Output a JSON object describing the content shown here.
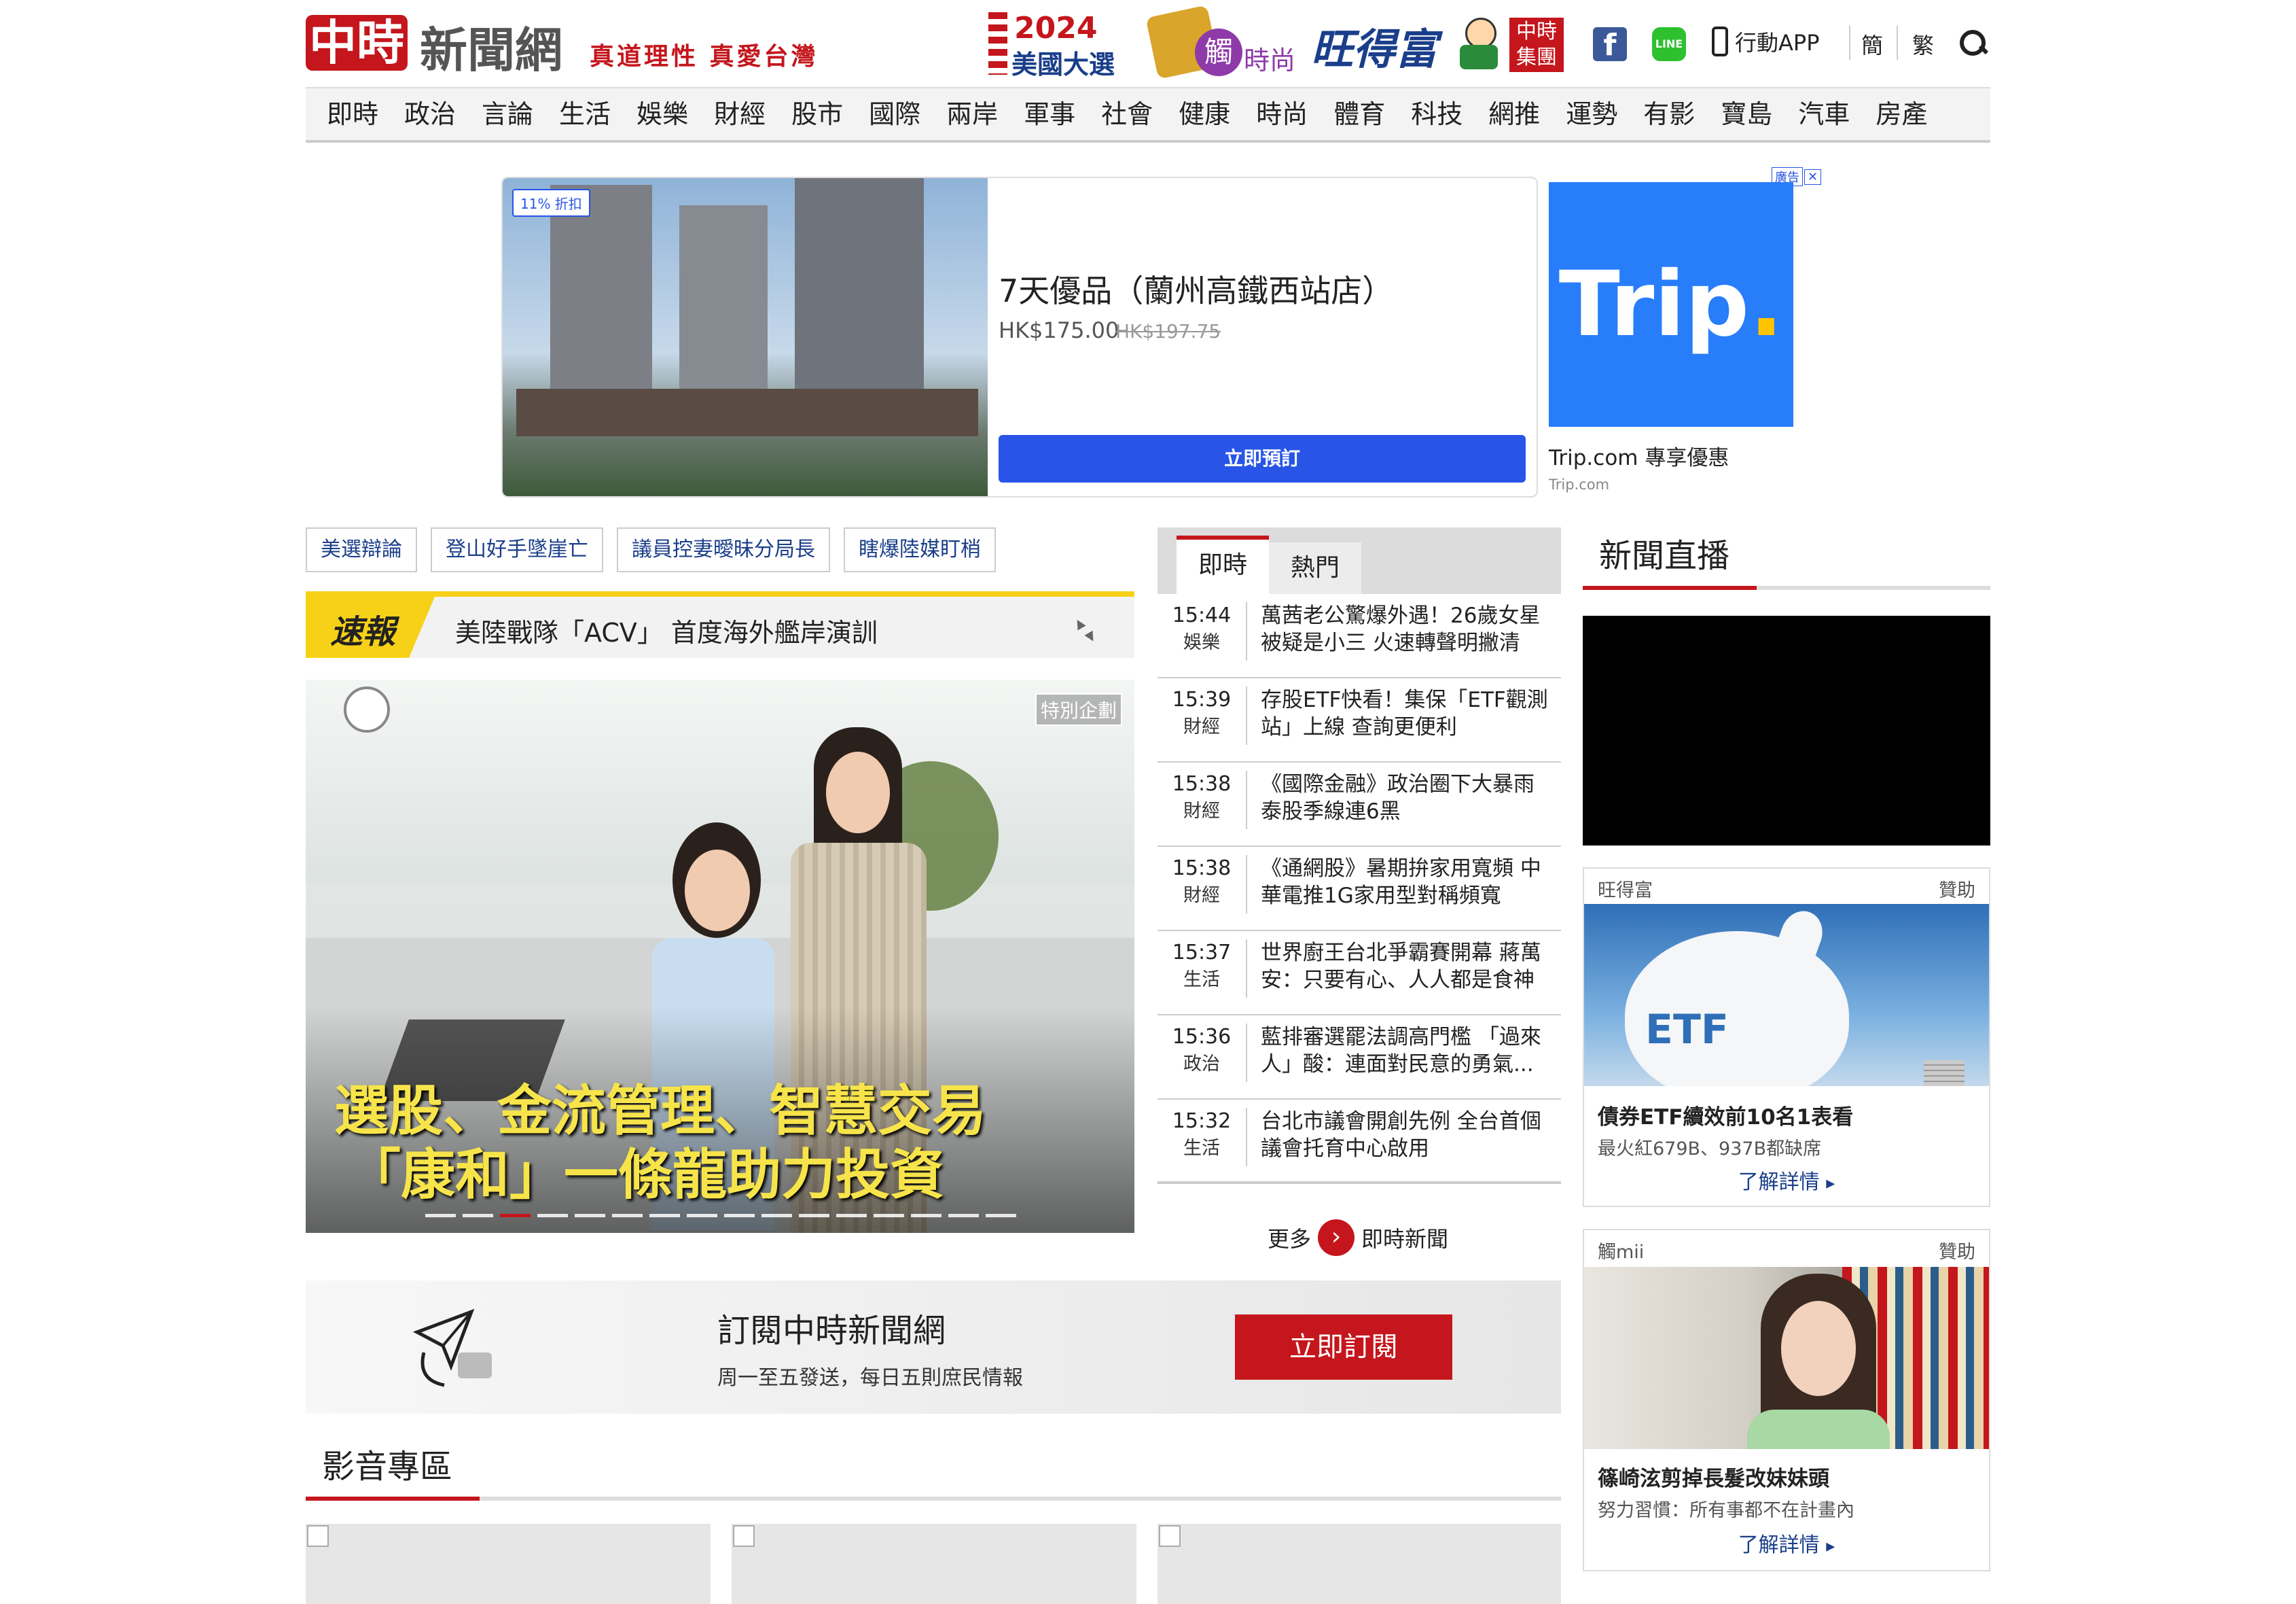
{
  "header": {
    "logo_box": "中時",
    "logo_text": "新聞網",
    "slogan": "真道理性 真愛台灣",
    "partner_election_year": "2024",
    "partner_election_label": "美國大選",
    "partner_fashion_char": "觸",
    "partner_fashion_label": "時尚",
    "partner_want": "旺得富",
    "partner_group": "中時集團",
    "app_label": "行動APP",
    "lang_simplified": "簡",
    "lang_traditional": "繁"
  },
  "categories": [
    "即時",
    "政治",
    "言論",
    "生活",
    "娛樂",
    "財經",
    "股市",
    "國際",
    "兩岸",
    "軍事",
    "社會",
    "健康",
    "時尚",
    "體育",
    "科技",
    "網推",
    "運勢",
    "有影",
    "寶島",
    "汽車",
    "房產"
  ],
  "ad": {
    "discount_badge": "11% 折扣",
    "hotel_name": "7天優品（蘭州高鐵西站店）",
    "price": "HK$175.00",
    "original_price": "HK$197.75",
    "book_button": "立即預訂",
    "ad_label": "廣告",
    "brand_logo": "Trip",
    "brand_dot": ".",
    "brand_title": "Trip.com 專享優惠",
    "brand_domain": "Trip.com"
  },
  "hot_tags": [
    "美選辯論",
    "登山好手墜崖亡",
    "議員控妻曖昧分局長",
    "瞎爆陸媒盯梢"
  ],
  "breaking": {
    "label": "速報",
    "headline": "美陸戰隊「ACV」 首度海外艦岸演訓"
  },
  "hero": {
    "badge": "特別企劃",
    "caption_line1": "選股、金流管理、智慧交易",
    "caption_line2": "「康和」一條龍助力投資",
    "dot_count": 16,
    "active_dot": 3
  },
  "live_tabs": [
    "即時",
    "熱門"
  ],
  "live_news": [
    {
      "time": "15:44",
      "category": "娛樂",
      "title": "萬茜老公驚爆外遇！26歲女星被疑是小三 火速轉聲明撇清"
    },
    {
      "time": "15:39",
      "category": "財經",
      "title": "存股ETF快看！集保「ETF觀測站」上線 查詢更便利"
    },
    {
      "time": "15:38",
      "category": "財經",
      "title": "《國際金融》政治圈下大暴雨 泰股季線連6黑"
    },
    {
      "time": "15:38",
      "category": "財經",
      "title": "《通網股》暑期拚家用寬頻 中華電推1G家用型對稱頻寬"
    },
    {
      "time": "15:37",
      "category": "生活",
      "title": "世界廚王台北爭霸賽開幕 蔣萬安：只要有心、人人都是食神"
    },
    {
      "time": "15:36",
      "category": "政治",
      "title": "藍排審選罷法調高門檻 「過來人」酸：連面對民意的勇氣..."
    },
    {
      "time": "15:32",
      "category": "生活",
      "title": "台北市議會開創先例 全台首個議會托育中心啟用"
    }
  ],
  "more_label": "更多",
  "more_target": "即時新聞",
  "newsletter": {
    "title": "訂閱中時新聞網",
    "subtitle": "周一至五發送，每日五則庶民情報",
    "button": "立即訂閱"
  },
  "video_section_title": "影音專區",
  "live_broadcast_title": "新聞直播",
  "sponsors": [
    {
      "source": "旺得富",
      "sponsor_label": "贊助",
      "image_text": "ETF",
      "title": "債券ETF續效前10名1表看",
      "desc": "最火紅679B、937B都缺席",
      "link": "了解詳情"
    },
    {
      "source": "觸mii",
      "sponsor_label": "贊助",
      "image_text": "",
      "title": "篠崎泫剪掉長髮改妹妹頭",
      "desc": "努力習慣：所有事都不在計畫內",
      "link": "了解詳情"
    }
  ],
  "colors": {
    "brand_red": "#c4161c",
    "breaking_yellow": "#f7d117",
    "book_blue": "#2855e8",
    "trip_blue": "#287dfa",
    "link_blue": "#1a3e8a"
  }
}
